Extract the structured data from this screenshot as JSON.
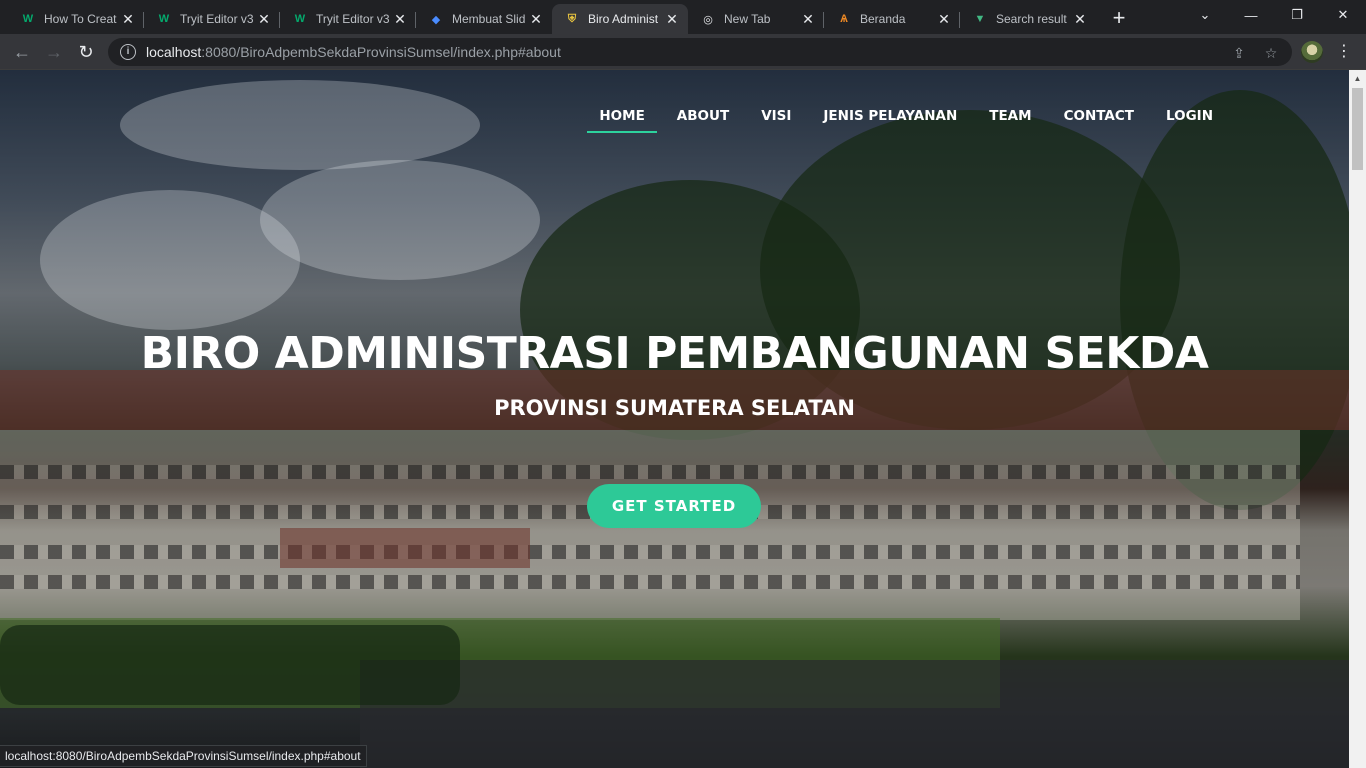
{
  "browser": {
    "tabs": [
      {
        "title": "How To Creat",
        "favicon": "w3schools-icon",
        "active": false
      },
      {
        "title": "Tryit Editor v3",
        "favicon": "w3schools-icon",
        "active": false
      },
      {
        "title": "Tryit Editor v3",
        "favicon": "w3schools-icon",
        "active": false
      },
      {
        "title": "Membuat Slid",
        "favicon": "code-icon",
        "active": false
      },
      {
        "title": "Biro Administ",
        "favicon": "emblem-icon",
        "active": true
      },
      {
        "title": "New Tab",
        "favicon": "chrome-icon",
        "active": false
      },
      {
        "title": "Beranda",
        "favicon": "logo-icon",
        "active": false
      },
      {
        "title": "Search result",
        "favicon": "vue-icon",
        "active": false
      }
    ],
    "new_tab_label": "+",
    "url_host": "localhost",
    "url_rest": ":8080/BiroAdpembSekdaProvinsiSumsel/index.php#about",
    "status_url": "localhost:8080/BiroAdpembSekdaProvinsiSumsel/index.php#about"
  },
  "site": {
    "nav": [
      {
        "label": "HOME",
        "active": true
      },
      {
        "label": "ABOUT",
        "active": false
      },
      {
        "label": "VISI",
        "active": false
      },
      {
        "label": "JENIS PELAYANAN",
        "active": false
      },
      {
        "label": "TEAM",
        "active": false
      },
      {
        "label": "CONTACT",
        "active": false
      },
      {
        "label": "LOGIN",
        "active": false
      }
    ],
    "hero": {
      "title": "BIRO ADMINISTRASI PEMBANGUNAN SEKDA",
      "subtitle": "PROVINSI SUMATERA SELATAN",
      "cta": "GET STARTED"
    }
  },
  "colors": {
    "accent": "#2dc997",
    "chrome_dark": "#202124",
    "chrome_toolbar": "#35363a"
  }
}
